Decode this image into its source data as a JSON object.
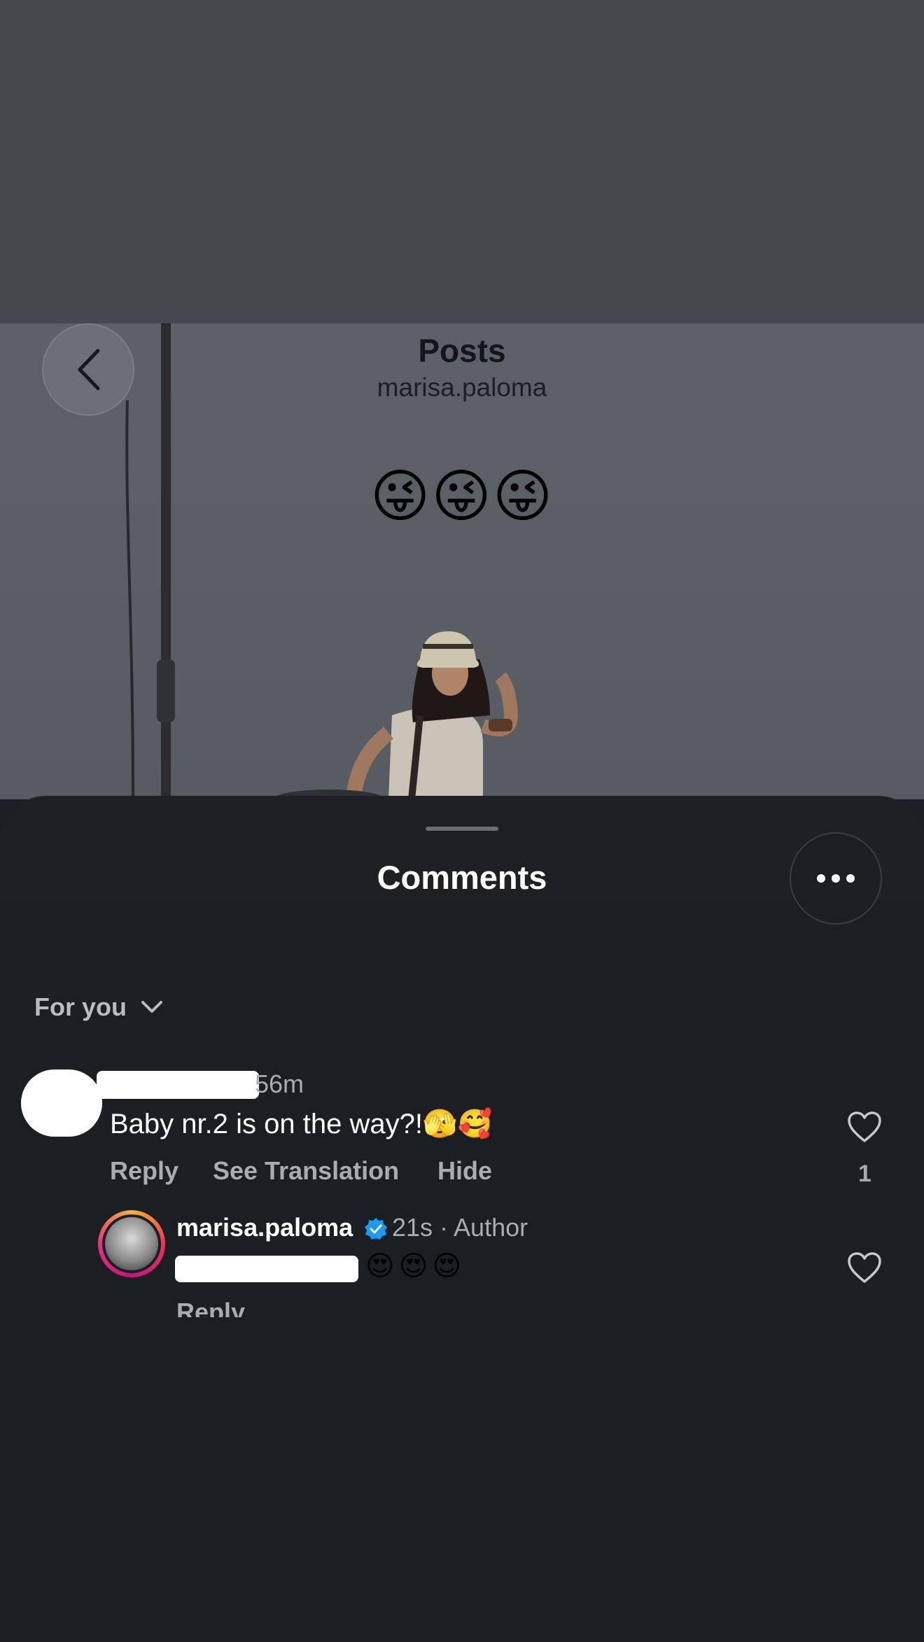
{
  "header": {
    "title": "Posts",
    "username": "marisa.paloma"
  },
  "post": {
    "caption": "😜😜😜"
  },
  "sheet": {
    "title": "Comments"
  },
  "sort": {
    "label": "For you"
  },
  "comments": [
    {
      "time": "56m",
      "text": "Baby nr.2 is on the way?!🫣🥰",
      "actions": [
        "Reply",
        "See Translation",
        "Hide"
      ],
      "likes": "1"
    }
  ],
  "reply": {
    "username": "marisa.paloma",
    "meta": "21s · Author",
    "text": "😍😍😍",
    "action": "Reply"
  },
  "colors": {
    "verified": "#1d9bf0",
    "background": "#1b1e22"
  },
  "icons": [
    "back-icon",
    "more-icon",
    "chevron-down-icon",
    "heart-icon",
    "verified-icon"
  ]
}
